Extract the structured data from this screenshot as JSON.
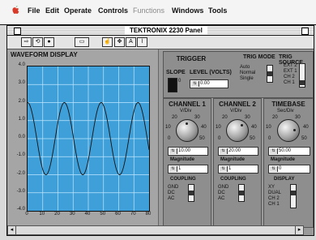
{
  "menu": {
    "items": [
      {
        "label": "File",
        "dim": false
      },
      {
        "label": "Edit",
        "dim": false
      },
      {
        "label": "Operate",
        "dim": false
      },
      {
        "label": "Controls",
        "dim": false
      },
      {
        "label": "Functions",
        "dim": true
      },
      {
        "label": "Windows",
        "dim": false
      },
      {
        "label": "Tools",
        "dim": false
      }
    ]
  },
  "window": {
    "title": "TEKTRONIX 2230 Panel"
  },
  "waveform": {
    "title": "WAVEFORM DISPLAY",
    "y_ticks": [
      "4.0",
      "3.0",
      "2.0",
      "1.0",
      "0.0",
      "-1.0",
      "-2.0",
      "-3.0",
      "-4.0"
    ],
    "x_ticks": [
      "0",
      "10",
      "20",
      "30",
      "40",
      "50",
      "60",
      "70",
      "80"
    ],
    "trace_color": "#111111",
    "plot_color": "#3f9fd8"
  },
  "trigger": {
    "title": "TRIGGER",
    "slope_label": "SLOPE",
    "level_label": "LEVEL (VOLTS)",
    "level_value": "0.00",
    "slope_value": "0",
    "trig_mode": {
      "title": "TRIG MODE",
      "options": [
        "Auto",
        "Normal",
        "Single"
      ]
    },
    "trig_source": {
      "title": "TRIG SOURCE",
      "options": [
        "EXT 2",
        "EXT 1",
        "CH 2",
        "CH 1"
      ]
    }
  },
  "channel1": {
    "title": "CHANNEL 1",
    "unit": "V/Div",
    "scale": [
      "20",
      "30",
      "10",
      "40",
      "0",
      "50"
    ],
    "value": "10.00",
    "mag_label": "Magnitude",
    "mag_value": "1",
    "coupling_label": "COUPLING",
    "coupling_options": [
      "GND",
      "DC",
      "AC"
    ]
  },
  "channel2": {
    "title": "CHANNEL 2",
    "unit": "V/Div",
    "scale": [
      "20",
      "30",
      "10",
      "40",
      "0",
      "50"
    ],
    "value": "20.00",
    "mag_label": "Magnitude",
    "mag_value": "1",
    "coupling_label": "COUPLING",
    "coupling_options": [
      "GND",
      "DC",
      "AC"
    ]
  },
  "timebase": {
    "title": "TIMEBASE",
    "unit": "Sec/Div",
    "scale": [
      "20",
      "30",
      "10",
      "40",
      "0",
      "50"
    ],
    "value": "50.00",
    "mag_label": "Magnitude",
    "mag_value": "0",
    "display_label": "DISPLAY",
    "display_options": [
      "XY",
      "DUAL",
      "CH 2",
      "CH 1"
    ]
  }
}
